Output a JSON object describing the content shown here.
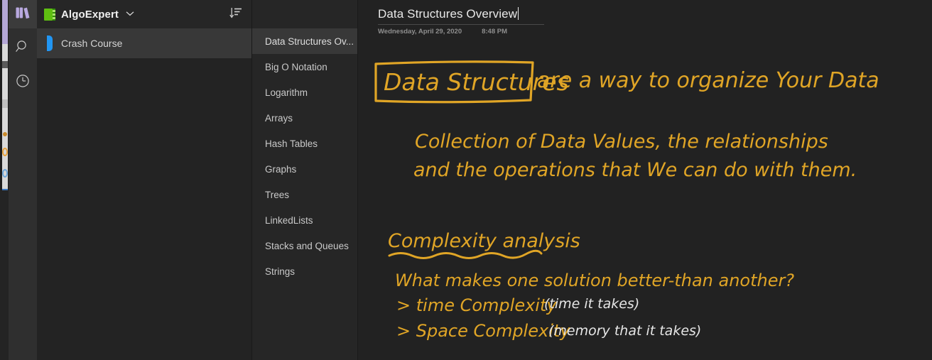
{
  "colors": {
    "app_bg": "#222222",
    "rail_bg": "#2f2f2f",
    "panel_bg": "#262626",
    "selected_bg": "#383838",
    "notebook_green": "#5fbf11",
    "section_blue": "#2196f3",
    "rail_active_purple": "#b9a9e0",
    "ink_gold": "#e0a526",
    "ink_white": "#e6e6e6",
    "text_primary": "#e8e8e8",
    "text_secondary": "#c9c9c9",
    "text_muted": "#8f8f8f"
  },
  "rail": {
    "items": [
      {
        "name": "notebooks-icon",
        "label": "Notebooks",
        "active": true
      },
      {
        "name": "search-icon",
        "label": "Search",
        "active": false
      },
      {
        "name": "recent-notes-icon",
        "label": "Recent Notes",
        "active": false
      }
    ]
  },
  "notebook_header": {
    "icon": "notebook-icon",
    "name": "AlgoExpert",
    "chevron": "⌄",
    "sort_icon": "sort-descending-icon"
  },
  "sections": {
    "items": [
      {
        "label": "Crash Course",
        "selected": true
      }
    ]
  },
  "pages": {
    "items": [
      {
        "label": "Data Structures Ov...",
        "selected": true
      },
      {
        "label": "Big O Notation",
        "selected": false
      },
      {
        "label": "Logarithm",
        "selected": false
      },
      {
        "label": "Arrays",
        "selected": false
      },
      {
        "label": "Hash Tables",
        "selected": false
      },
      {
        "label": "Graphs",
        "selected": false
      },
      {
        "label": "Trees",
        "selected": false
      },
      {
        "label": "LinkedLists",
        "selected": false
      },
      {
        "label": "Stacks and Queues",
        "selected": false
      },
      {
        "label": "Strings",
        "selected": false
      }
    ]
  },
  "note": {
    "title": "Data Structures Overview",
    "date": "Wednesday, April 29, 2020",
    "time": "8:48 PM",
    "ink": {
      "heading_boxed": "Data Structures",
      "heading_rest": "are a way to organize Your Data",
      "body_line_1": "Collection of Data Values, the relationships",
      "body_line_2": "and the operations that We can do with them.",
      "subheading": "Complexity analysis",
      "question": "What makes one solution better-than another?",
      "bullet_1_key": "> time Complexity",
      "bullet_1_note": "(time it takes)",
      "bullet_2_key": "> Space Complexity",
      "bullet_2_note": "(memory that it takes)"
    }
  }
}
